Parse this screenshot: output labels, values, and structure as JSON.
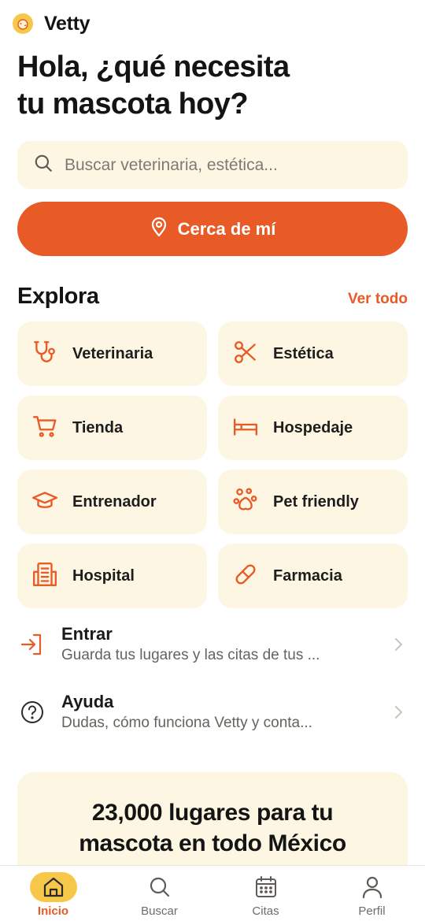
{
  "app": {
    "name": "Vetty"
  },
  "headline": {
    "line1": "Hola, ¿qué necesita",
    "line2": "tu mascota hoy?"
  },
  "search": {
    "placeholder": "Buscar veterinaria, estética..."
  },
  "near_button": {
    "label": "Cerca de mí",
    "icon": "location-pin-icon"
  },
  "explore": {
    "title": "Explora",
    "see_all": "Ver todo",
    "categories": [
      {
        "label": "Veterinaria",
        "icon": "stethoscope-icon"
      },
      {
        "label": "Estética",
        "icon": "scissors-icon"
      },
      {
        "label": "Tienda",
        "icon": "cart-icon"
      },
      {
        "label": "Hospedaje",
        "icon": "bed-icon"
      },
      {
        "label": "Entrenador",
        "icon": "graduation-cap-icon"
      },
      {
        "label": "Pet friendly",
        "icon": "paw-icon"
      },
      {
        "label": "Hospital",
        "icon": "hospital-icon"
      },
      {
        "label": "Farmacia",
        "icon": "pill-icon"
      }
    ]
  },
  "rows": [
    {
      "title": "Entrar",
      "subtitle": "Guarda tus lugares y las citas de tus ...",
      "icon": "login-icon"
    },
    {
      "title": "Ayuda",
      "subtitle": "Dudas, cómo funciona Vetty y conta...",
      "icon": "help-icon"
    }
  ],
  "promo": {
    "line1": "23,000 lugares para tu",
    "line2": "mascota en todo México"
  },
  "tabs": [
    {
      "label": "Inicio",
      "icon": "home-icon",
      "active": true
    },
    {
      "label": "Buscar",
      "icon": "search-icon",
      "active": false
    },
    {
      "label": "Citas",
      "icon": "calendar-icon",
      "active": false
    },
    {
      "label": "Perfil",
      "icon": "user-icon",
      "active": false
    }
  ],
  "colors": {
    "accent": "#e85a26",
    "highlight": "#f7c74a",
    "surface": "#fdf6e3"
  }
}
